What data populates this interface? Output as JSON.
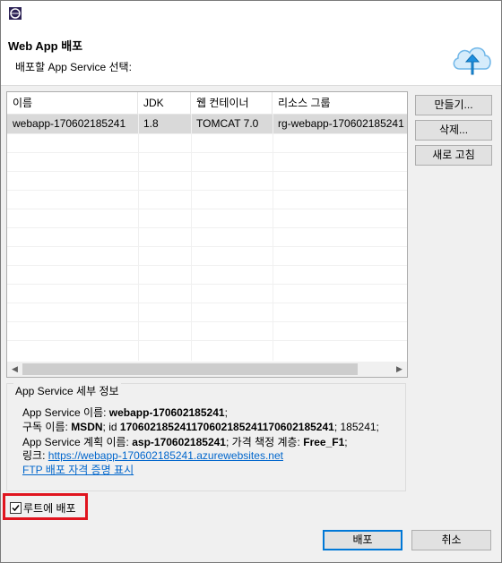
{
  "header": {
    "title": "Web App 배포",
    "subtitle": "배포할 App Service 선택:"
  },
  "table": {
    "columns": [
      "이름",
      "JDK",
      "웹 컨테이너",
      "리소스 그룹"
    ],
    "rows": [
      [
        "webapp-170602185241",
        "1.8",
        "TOMCAT 7.0",
        "rg-webapp-170602185241"
      ]
    ]
  },
  "side_buttons": {
    "create": "만들기...",
    "delete": "삭제...",
    "refresh": "새로 고침"
  },
  "details": {
    "group_title": "App Service 세부 정보",
    "name_label": "App Service 이름:",
    "name_value": "webapp-170602185241",
    "name_suffix": ";",
    "sub_label": "구독 이름:",
    "sub_name": "MSDN",
    "sub_id_label": "; id",
    "sub_id": "170602185241170602185241170602185241",
    "sub_id_tail": "; 185241;",
    "plan_label": "App Service 계획 이름:",
    "plan_value": "asp-170602185241",
    "tier_label": "; 가격 책정 계층:",
    "tier_value": "Free_F1",
    "tier_suffix": ";",
    "link_label": "링크:",
    "link_url": "https://webapp-170602185241.azurewebsites.net",
    "ftp_link": "FTP 배포 자격 증명 표시"
  },
  "deploy_root": {
    "label": "루트에 배포",
    "checked": true
  },
  "footer": {
    "deploy": "배포",
    "cancel": "취소"
  },
  "colors": {
    "highlight_border": "#e0141e",
    "link": "#0066cc",
    "selected_row": "#d9d9d9"
  }
}
